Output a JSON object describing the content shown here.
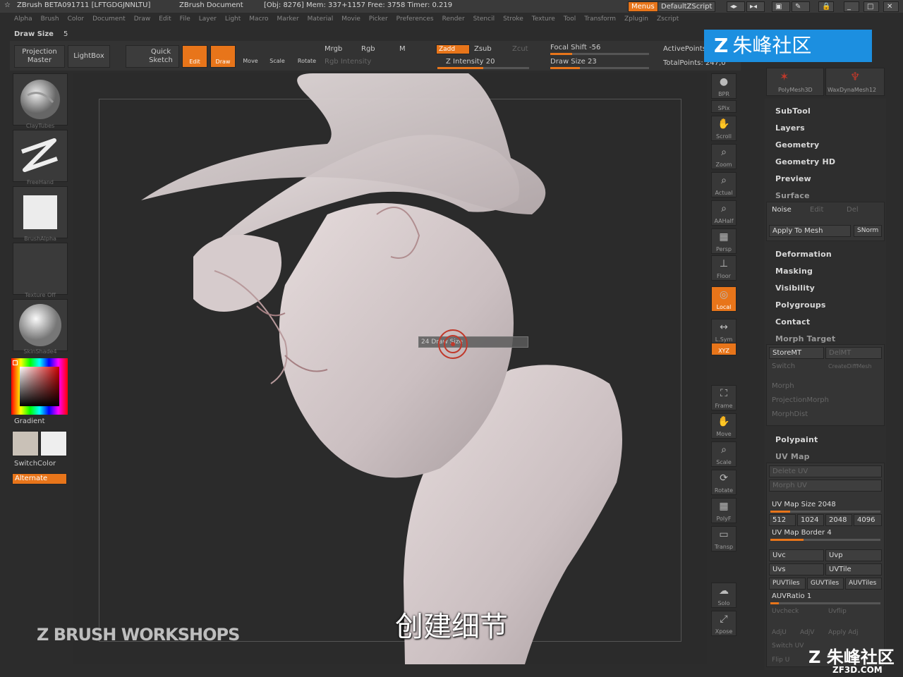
{
  "titlebar": {
    "app": "ZBrush BETA091711 [LFTGDGJNNLTU]",
    "doc": "ZBrush Document",
    "stats": "[Obj: 8276] Mem: 337+1157 Free: 3758 Timer: 0.219",
    "menus_btn": "Menus",
    "script_btn": "DefaultZScript"
  },
  "menubar": [
    "Alpha",
    "Brush",
    "Color",
    "Document",
    "Draw",
    "Edit",
    "File",
    "Layer",
    "Light",
    "Macro",
    "Marker",
    "Material",
    "Movie",
    "Picker",
    "Preferences",
    "Render",
    "Stencil",
    "Stroke",
    "Texture",
    "Tool",
    "Transform",
    "Zplugin",
    "Zscript"
  ],
  "drawsize_label": "Draw Size",
  "drawsize_value": "5",
  "toolbar": {
    "projection_master": "Projection Master",
    "lightbox": "LightBox",
    "quick_sketch": "Quick Sketch",
    "edit": "Edit",
    "draw": "Draw",
    "move": "Move",
    "scale": "Scale",
    "rotate": "Rotate",
    "mrgb": "Mrgb",
    "rgb": "Rgb",
    "m": "M",
    "zadd": "Zadd",
    "zsub": "Zsub",
    "zcut": "Zcut",
    "rgb_intensity": "Rgb Intensity",
    "z_intensity": "Z Intensity 20",
    "focal_shift": "Focal Shift -56",
    "draw_size": "Draw Size 23",
    "active_points": "ActivePoints",
    "total_points": "TotalPoints: 247,0"
  },
  "left": {
    "brush_label": "ClayTubes",
    "stroke_label": "FreeHand",
    "alpha_label": "BrushAlpha",
    "texture_label": "Texture Off",
    "material_label": "SkinShade4",
    "gradient": "Gradient",
    "switchcolor": "SwitchColor",
    "alternate": "Alternate",
    "main_color": "#c9c1b7",
    "secondary_color": "#eeeeee"
  },
  "canvas": {
    "brush_tooltip": "24 Draw Size",
    "subtitle": "创建细节",
    "workshops": "Z BRUSH WORKSHOPS"
  },
  "right_toolbar": [
    {
      "icon": "sphere-icon",
      "label": "BPR"
    },
    {
      "icon": "spix-icon",
      "label": "SPix"
    },
    {
      "icon": "hand-icon",
      "label": "Scroll"
    },
    {
      "icon": "zoom-icon",
      "label": "Zoom"
    },
    {
      "icon": "actual-icon",
      "label": "Actual"
    },
    {
      "icon": "aahalf-icon",
      "label": "AAHalf"
    },
    {
      "icon": "persp-icon",
      "label": "Persp"
    },
    {
      "icon": "floor-icon",
      "label": "Floor"
    },
    {
      "icon": "local-icon",
      "label": "Local"
    },
    {
      "icon": "lsym-icon",
      "label": "L.Sym"
    },
    {
      "icon": "xyz-icon",
      "label": "XYZ"
    },
    {
      "icon": "frame-icon",
      "label": "Frame"
    },
    {
      "icon": "move-icon",
      "label": "Move"
    },
    {
      "icon": "scale-icon",
      "label": "Scale"
    },
    {
      "icon": "rotate-icon",
      "label": "Rotate"
    },
    {
      "icon": "polyf-icon",
      "label": "PolyF"
    },
    {
      "icon": "transp-icon",
      "label": "Transp"
    },
    {
      "icon": "solo-icon",
      "label": "Solo"
    },
    {
      "icon": "xpose-icon",
      "label": "Xpose"
    }
  ],
  "right_panel": {
    "polymesh": "PolyMesh3D",
    "dynamesh": "WaxDynaMesh12",
    "subtool": "SubTool",
    "layers": "Layers",
    "geometry": "Geometry",
    "geometry_hd": "Geometry HD",
    "preview": "Preview",
    "surface": "Surface",
    "noise": "Noise",
    "edit": "Edit",
    "del": "Del",
    "apply_to_mesh": "Apply To Mesh",
    "snorm": "SNorm",
    "deformation": "Deformation",
    "masking": "Masking",
    "visibility": "Visibility",
    "polygroups": "Polygroups",
    "contact": "Contact",
    "morph_target": "Morph Target",
    "storemt": "StoreMT",
    "delmt": "DelMT",
    "switch": "Switch",
    "createdifmesh": "CreateDiffMesh",
    "morph": "Morph",
    "morph_brush": "ProjectionMorph",
    "morph_dist": "MorphDist",
    "polypaint": "Polypaint",
    "uv_map": "UV Map",
    "delete_uv": "Delete UV",
    "morph_uv": "Morph UV",
    "uv_map_size": "UV Map Size 2048",
    "sizes": [
      "512",
      "1024",
      "2048",
      "4096"
    ],
    "uv_map_border": "UV Map Border 4",
    "uvc": "Uvc",
    "uvp": "Uvp",
    "uvs": "Uvs",
    "uvtile": "UVTile",
    "puvtiles": "PUVTiles",
    "guvtiles": "GUVTiles",
    "auvtiles": "AUVTiles",
    "auvratio": "AUVRatio 1",
    "uvcheck": "Uvcheck",
    "uvflip": "Uvflip",
    "adju": "AdjU",
    "adjv": "AdjV",
    "apply_adj": "Apply Adj",
    "switch_uv": "Switch UV",
    "flip_u": "Flip U"
  },
  "watermark": {
    "top": "朱峰社区",
    "bottom": "朱峰社区",
    "bottom_url": "ZF3D.COM"
  }
}
